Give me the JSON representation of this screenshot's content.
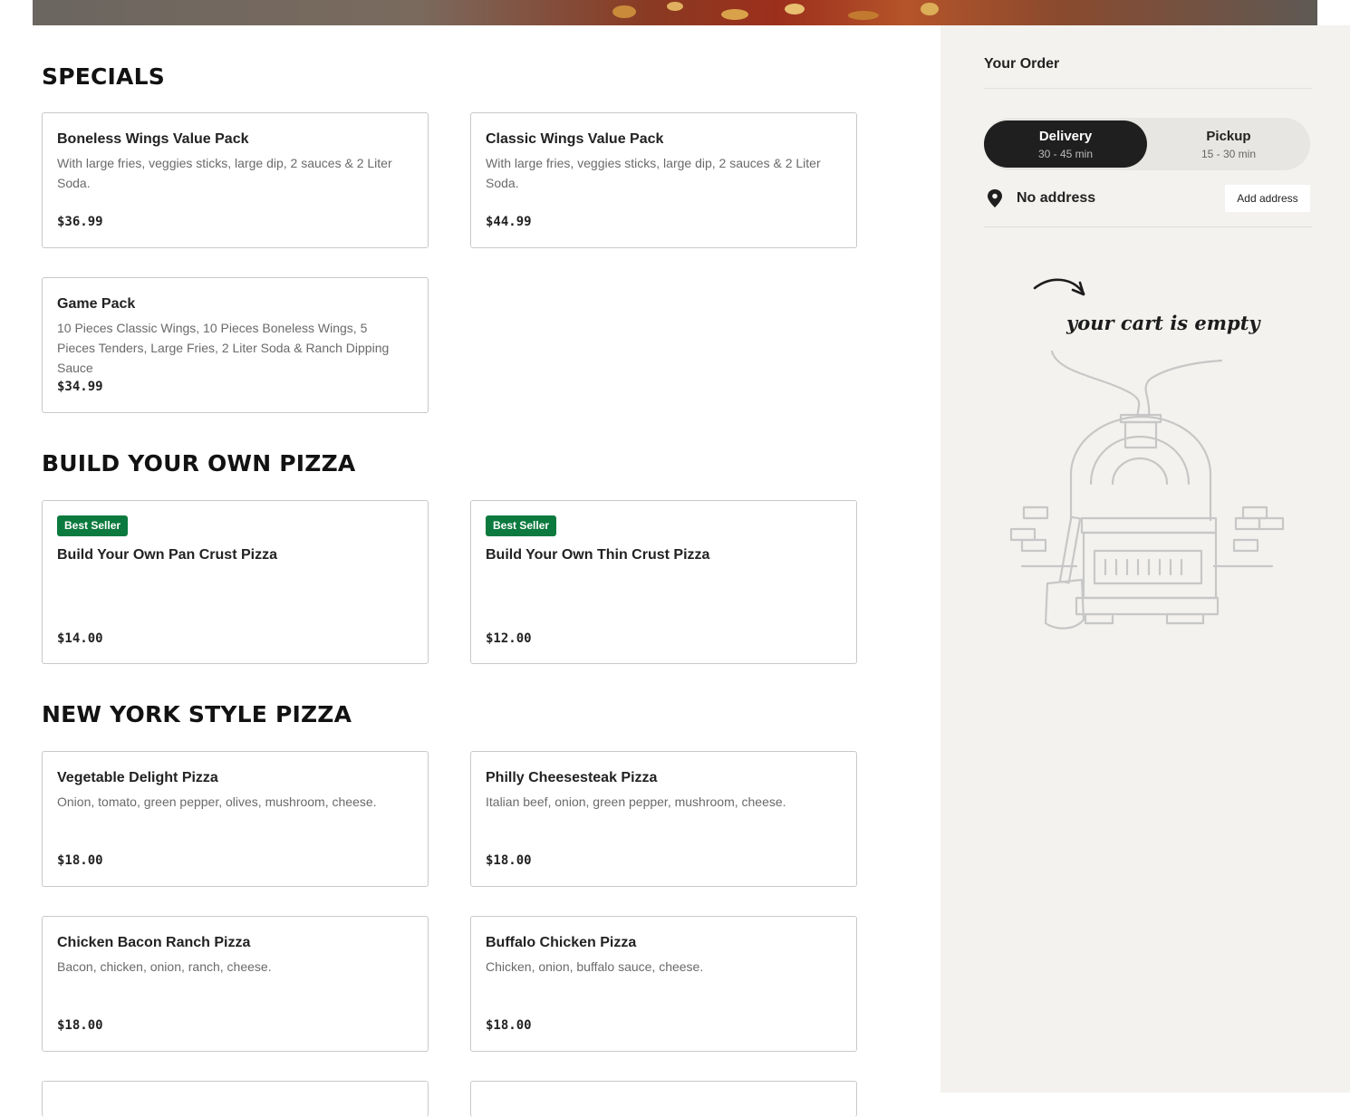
{
  "hero": {
    "image": "pizza-banner-image"
  },
  "menu": {
    "sections": [
      {
        "title": "SPECIALS",
        "items": [
          {
            "name": "Boneless Wings Value Pack",
            "description": "With large fries, veggies sticks, large dip, 2 sauces & 2 Liter Soda.",
            "price": "$36.99"
          },
          {
            "name": "Classic Wings Value Pack",
            "description": "With large fries, veggies sticks, large dip, 2 sauces & 2 Liter Soda.",
            "price": "$44.99"
          },
          {
            "name": "Game Pack",
            "description": "10 Pieces Classic Wings, 10 Pieces Boneless Wings, 5 Pieces Tenders, Large Fries, 2 Liter Soda & Ranch Dipping Sauce",
            "price": "$34.99"
          }
        ]
      },
      {
        "title": "BUILD YOUR OWN PIZZA",
        "items": [
          {
            "badge": "Best Seller",
            "name": "Build Your Own Pan Crust Pizza",
            "price": "$14.00"
          },
          {
            "badge": "Best Seller",
            "name": "Build Your Own Thin Crust Pizza",
            "price": "$12.00"
          }
        ]
      },
      {
        "title": "NEW YORK STYLE PIZZA",
        "items": [
          {
            "name": "Vegetable Delight Pizza",
            "description": "Onion, tomato, green pepper, olives, mushroom, cheese.",
            "price": "$18.00"
          },
          {
            "name": "Philly Cheesesteak Pizza",
            "description": "Italian beef, onion, green pepper, mushroom, cheese.",
            "price": "$18.00"
          },
          {
            "name": "Chicken Bacon Ranch Pizza",
            "description": "Bacon, chicken, onion, ranch, cheese.",
            "price": "$18.00"
          },
          {
            "name": "Buffalo Chicken Pizza",
            "description": "Chicken, onion, buffalo sauce, cheese.",
            "price": "$18.00"
          }
        ]
      }
    ]
  },
  "order": {
    "title": "Your Order",
    "delivery": {
      "label": "Delivery",
      "time": "30 - 45 min",
      "selected": true
    },
    "pickup": {
      "label": "Pickup",
      "time": "15 - 30 min",
      "selected": false
    },
    "address": {
      "icon": "location-pin-icon",
      "text": "No address",
      "button": "Add address"
    },
    "empty_cart": {
      "message": "your cart is empty",
      "illustration": "pizza-oven-illustration"
    }
  },
  "colors": {
    "badge": "#0c7a3e",
    "sidebar_bg": "#f3f2ef",
    "toggle_active": "#1f1f1f",
    "card_border": "#c9c9c9"
  }
}
